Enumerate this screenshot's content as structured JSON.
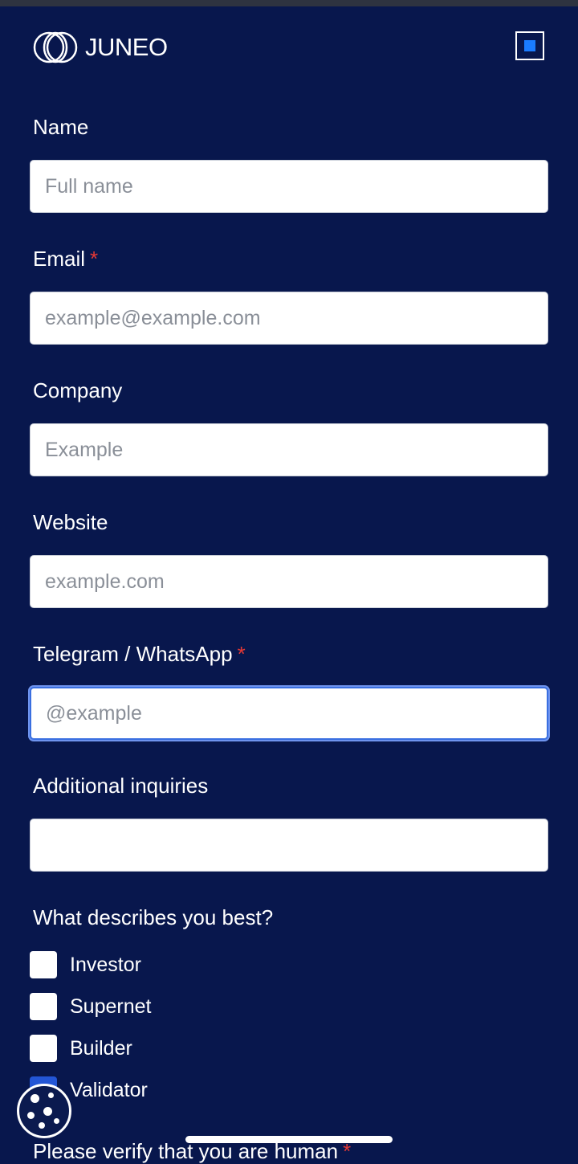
{
  "brand": {
    "name": "JUNEO"
  },
  "form": {
    "name": {
      "label": "Name",
      "placeholder": "Full name",
      "value": ""
    },
    "email": {
      "label": "Email",
      "required_mark": "*",
      "placeholder": "example@example.com",
      "value": ""
    },
    "company": {
      "label": "Company",
      "placeholder": "Example",
      "value": ""
    },
    "website": {
      "label": "Website",
      "placeholder": "example.com",
      "value": ""
    },
    "telegram": {
      "label": "Telegram / WhatsApp",
      "required_mark": "*",
      "placeholder": "@example",
      "value": ""
    },
    "inquiries": {
      "label": "Additional inquiries",
      "placeholder": "",
      "value": ""
    },
    "describe": {
      "label": "What describes you best?",
      "options": [
        {
          "label": "Investor",
          "checked": false
        },
        {
          "label": "Supernet",
          "checked": false
        },
        {
          "label": "Builder",
          "checked": false
        },
        {
          "label": "Validator",
          "checked": true
        }
      ]
    },
    "verify": {
      "label": "Please verify that you are human",
      "required_mark": "*"
    }
  },
  "colors": {
    "background": "#08174d",
    "accent": "#1a7cff",
    "required": "#e53935"
  },
  "icons": {
    "logo": "juneo-rings-logo",
    "menu": "menu-square-icon",
    "cookie": "cookie-icon"
  }
}
